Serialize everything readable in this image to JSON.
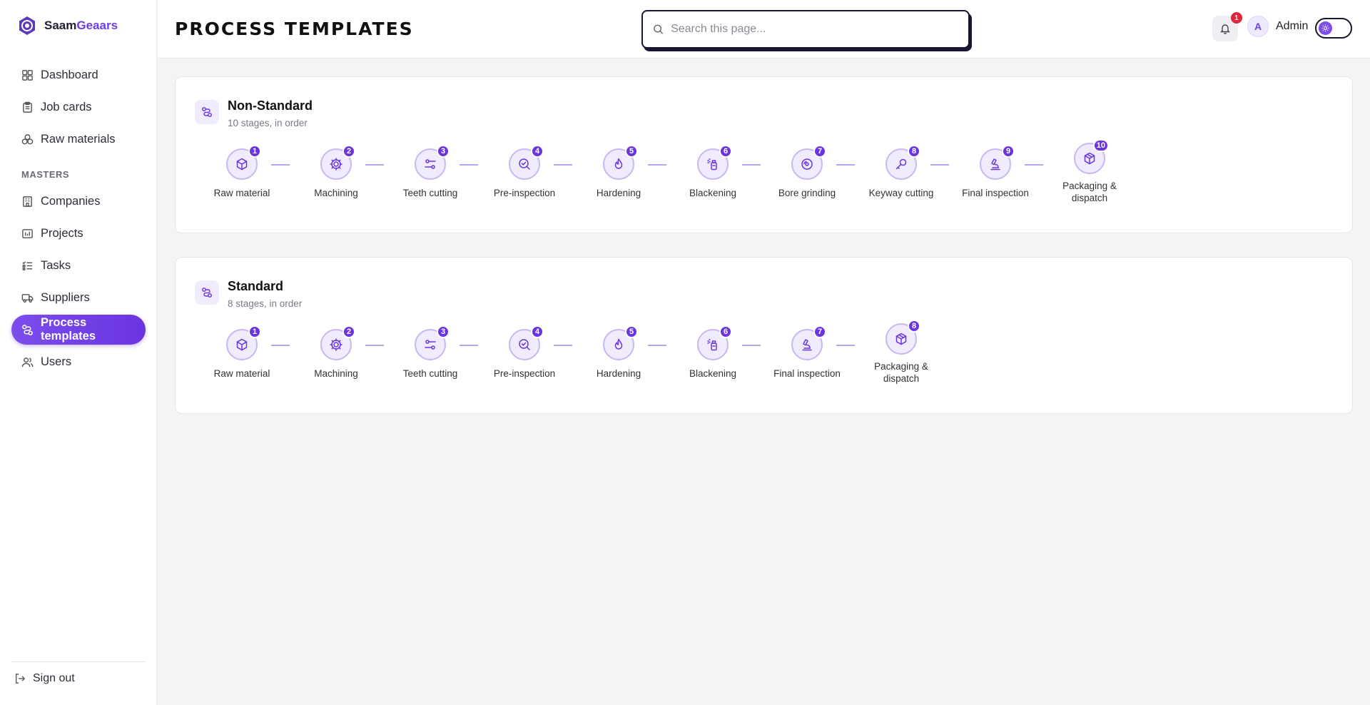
{
  "brand": {
    "name_part1": "Saam",
    "name_part2": "Geaars"
  },
  "sidebar": {
    "items": [
      {
        "label": "Dashboard",
        "icon": "dashboard-icon"
      },
      {
        "label": "Job cards",
        "icon": "clipboard-icon"
      },
      {
        "label": "Raw materials",
        "icon": "boxes-icon"
      }
    ],
    "section_label": "MASTERS",
    "masters": [
      {
        "label": "Companies",
        "icon": "building-icon"
      },
      {
        "label": "Projects",
        "icon": "chart-icon"
      },
      {
        "label": "Tasks",
        "icon": "list-icon"
      },
      {
        "label": "Suppliers",
        "icon": "truck-icon"
      },
      {
        "label": "Process templates",
        "icon": "route-icon",
        "active": true
      },
      {
        "label": "Users",
        "icon": "users-icon"
      }
    ],
    "signout_label": "Sign out"
  },
  "header": {
    "title": "PROCESS TEMPLATES",
    "search_placeholder": "Search this page...",
    "notification_count": "1",
    "avatar_initial": "A",
    "user_name": "Admin"
  },
  "templates": [
    {
      "title": "Non-Standard",
      "subtitle": "10 stages, in order",
      "stages": [
        {
          "num": "1",
          "label": "Raw material",
          "icon": "cube-icon"
        },
        {
          "num": "2",
          "label": "Machining",
          "icon": "cog-icon"
        },
        {
          "num": "3",
          "label": "Teeth cutting",
          "icon": "sliders-icon"
        },
        {
          "num": "4",
          "label": "Pre-inspection",
          "icon": "search-check-icon"
        },
        {
          "num": "5",
          "label": "Hardening",
          "icon": "flame-icon"
        },
        {
          "num": "6",
          "label": "Blackening",
          "icon": "spray-icon"
        },
        {
          "num": "7",
          "label": "Bore grinding",
          "icon": "disc-icon"
        },
        {
          "num": "8",
          "label": "Keyway cutting",
          "icon": "key-icon"
        },
        {
          "num": "9",
          "label": "Final inspection",
          "icon": "microscope-icon"
        },
        {
          "num": "10",
          "label": "Packaging & dispatch",
          "icon": "package-icon"
        }
      ]
    },
    {
      "title": "Standard",
      "subtitle": "8 stages, in order",
      "stages": [
        {
          "num": "1",
          "label": "Raw material",
          "icon": "cube-icon"
        },
        {
          "num": "2",
          "label": "Machining",
          "icon": "cog-icon"
        },
        {
          "num": "3",
          "label": "Teeth cutting",
          "icon": "sliders-icon"
        },
        {
          "num": "4",
          "label": "Pre-inspection",
          "icon": "search-check-icon"
        },
        {
          "num": "5",
          "label": "Hardening",
          "icon": "flame-icon"
        },
        {
          "num": "6",
          "label": "Blackening",
          "icon": "spray-icon"
        },
        {
          "num": "7",
          "label": "Final inspection",
          "icon": "microscope-icon"
        },
        {
          "num": "8",
          "label": "Packaging & dispatch",
          "icon": "package-icon"
        }
      ]
    }
  ],
  "colors": {
    "accent": "#6a34e0",
    "badge": "#e0263a",
    "stage_bg": "#f1ecfd"
  }
}
